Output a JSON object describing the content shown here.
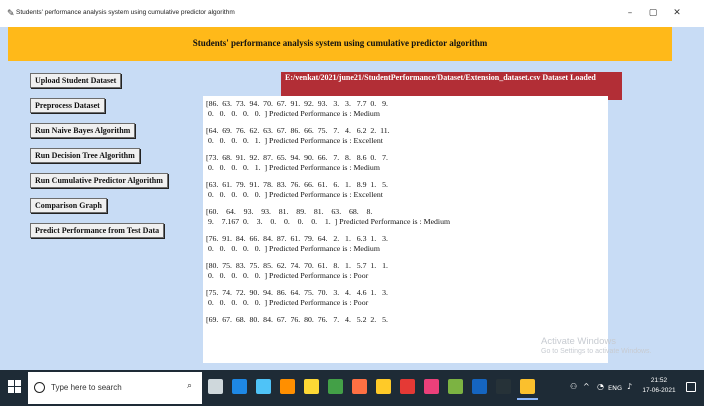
{
  "window": {
    "title": "Students' performance analysis system using cumulative predictor algorithm",
    "minimize_glyph": "–",
    "maximize_glyph": "▢",
    "close_glyph": "✕"
  },
  "header": {
    "title": "Students' performance analysis system using cumulative predictor algorithm"
  },
  "buttons": {
    "upload": "Upload Student Dataset",
    "preprocess": "Preprocess Dataset",
    "naive_bayes": "Run Naive Bayes Algorithm",
    "decision_tree": "Run Decision Tree Algorithm",
    "cumulative": "Run Cumulative Predictor Algorithm",
    "comparison": "Comparison Graph",
    "predict": "Predict Performance from Test Data"
  },
  "status": {
    "text": "E:/venkat/2021/june21/StudentPerformance/Dataset/Extension_dataset.csv Dataset Loaded"
  },
  "output": {
    "records": [
      {
        "line1": "[86.  63.  73.  94.  70.  67.  91.  92.  93.   3.   3.   7.7  0.   9.",
        "line2": " 0.   0.   0.   0.   0.  ] Predicted Performance is : Medium"
      },
      {
        "line1": "[64.  69.  76.  62.  63.  67.  86.  66.  75.   7.   4.   6.2  2.  11.",
        "line2": " 0.   0.   0.   0.   1.  ] Predicted Performance is : Excellent"
      },
      {
        "line1": "[73.  68.  91.  92.  87.  65.  94.  90.  66.   7.   8.   8.6  0.   7.",
        "line2": " 0.   0.   0.   0.   1.  ] Predicted Performance is : Medium"
      },
      {
        "line1": "[63.  61.  79.  91.  78.  83.  76.  66.  61.   6.   1.   8.9  1.   5.",
        "line2": " 0.   0.   0.   0.   0.  ] Predicted Performance is : Excellent"
      },
      {
        "line1": "[60.    64.    93.    93.    81.    89.    81.    63.    68.    8.",
        "line2": " 9.    7.167  0.    3.    0.    0.    0.    0.    1.  ] Predicted Performance is : Medium"
      },
      {
        "line1": "[76.  91.  84.  66.  84.  87.  61.  79.  64.   2.   1.   6.3  1.   3.",
        "line2": " 0.   0.   0.   0.   0.  ] Predicted Performance is : Medium"
      },
      {
        "line1": "[80.  75.  83.  75.  85.  62.  74.  70.  61.   8.   1.   5.7  1.   1.",
        "line2": " 0.   0.   0.   0.   0.  ] Predicted Performance is : Poor"
      },
      {
        "line1": "[75.  74.  72.  90.  94.  86.  64.  75.  70.   3.   4.   4.6  1.   3.",
        "line2": " 0.   0.   0.   0.   0.  ] Predicted Performance is : Poor"
      },
      {
        "line1": "[69.  67.  68.  80.  84.  67.  76.  80.  76.   7.   4.   5.2  2.   5.",
        "line2": ""
      }
    ]
  },
  "watermark": {
    "line1": "Activate Windows",
    "line2": "Go to Settings to activate Windows."
  },
  "taskbar": {
    "search_placeholder": "Type here to search",
    "time": "21:52",
    "date": "17-06-2021",
    "tray_lang": "ENG",
    "apps": [
      {
        "icon": "task-view-icon",
        "color": "#cfd8dc"
      },
      {
        "icon": "edge-icon",
        "color": "#1e88e5"
      },
      {
        "icon": "store-icon",
        "color": "#4fc3f7"
      },
      {
        "icon": "vlc-icon",
        "color": "#ff8f00"
      },
      {
        "icon": "paint-icon",
        "color": "#fdd835"
      },
      {
        "icon": "chrome-icon",
        "color": "#43a047"
      },
      {
        "icon": "firefox-icon",
        "color": "#ff7043"
      },
      {
        "icon": "explorer-icon",
        "color": "#ffca28"
      },
      {
        "icon": "pdf-icon",
        "color": "#e53935"
      },
      {
        "icon": "tool-icon",
        "color": "#ec407a"
      },
      {
        "icon": "notes-icon",
        "color": "#7cb342"
      },
      {
        "icon": "word-icon",
        "color": "#1565c0"
      },
      {
        "icon": "cmd-icon",
        "color": "#263238"
      },
      {
        "icon": "python-icon",
        "color": "#fbc02d"
      }
    ]
  },
  "colors": {
    "header_bg": "#ffb919",
    "client_bg": "#c8dcf5",
    "status_bg": "#b22e36",
    "taskbar_bg": "#1e2b36"
  }
}
